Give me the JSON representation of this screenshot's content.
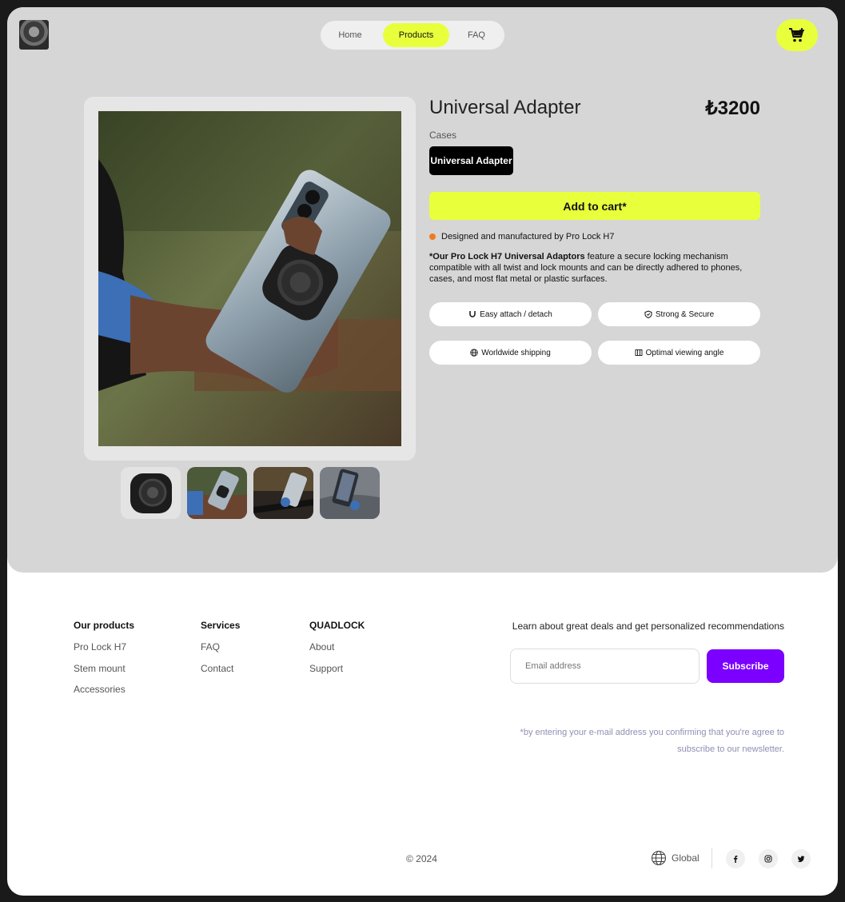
{
  "nav": {
    "items": [
      {
        "label": "Home"
      },
      {
        "label": "Products"
      },
      {
        "label": "FAQ"
      }
    ],
    "active": "Products"
  },
  "product": {
    "title": "Universal Adapter",
    "price": "₺3200",
    "category_label": "Cases",
    "variant": "Universal Adapter",
    "add_to_cart": "Add to cart*",
    "maker_note": "Designed and manufactured by Pro Lock H7",
    "description_bold": "*Our Pro Lock H7 Universal Adaptors",
    "description_rest": " feature a secure locking mechanism compatible with all twist and lock mounts and can be directly adhered to phones, cases, and most flat metal or plastic surfaces.",
    "features": [
      {
        "label": "Easy attach / detach",
        "icon": "magnet-icon"
      },
      {
        "label": "Strong & Secure",
        "icon": "shield-icon"
      },
      {
        "label": "Worldwide shipping",
        "icon": "globe-icon"
      },
      {
        "label": "Optimal viewing angle",
        "icon": "angle-icon"
      }
    ]
  },
  "footer": {
    "columns": [
      {
        "title": "Our products",
        "links": [
          "Pro Lock H7",
          "Stem mount",
          "Accessories"
        ]
      },
      {
        "title": "Services",
        "links": [
          "FAQ",
          "Contact"
        ]
      },
      {
        "title": "QUADLOCK",
        "links": [
          "About",
          "Support"
        ]
      }
    ],
    "newsletter_text": "Learn about great deals and get personalized recommendations",
    "email_placeholder": "Email address",
    "subscribe_label": "Subscribe",
    "disclaimer": "*by entering your e-mail address you confirming that you're agree to subscribe to our newsletter.",
    "copyright": "© 2024",
    "region": "Global"
  },
  "colors": {
    "accent": "#e8ff3c",
    "subscribe": "#7b00ff",
    "panel": "#d6d6d6"
  }
}
